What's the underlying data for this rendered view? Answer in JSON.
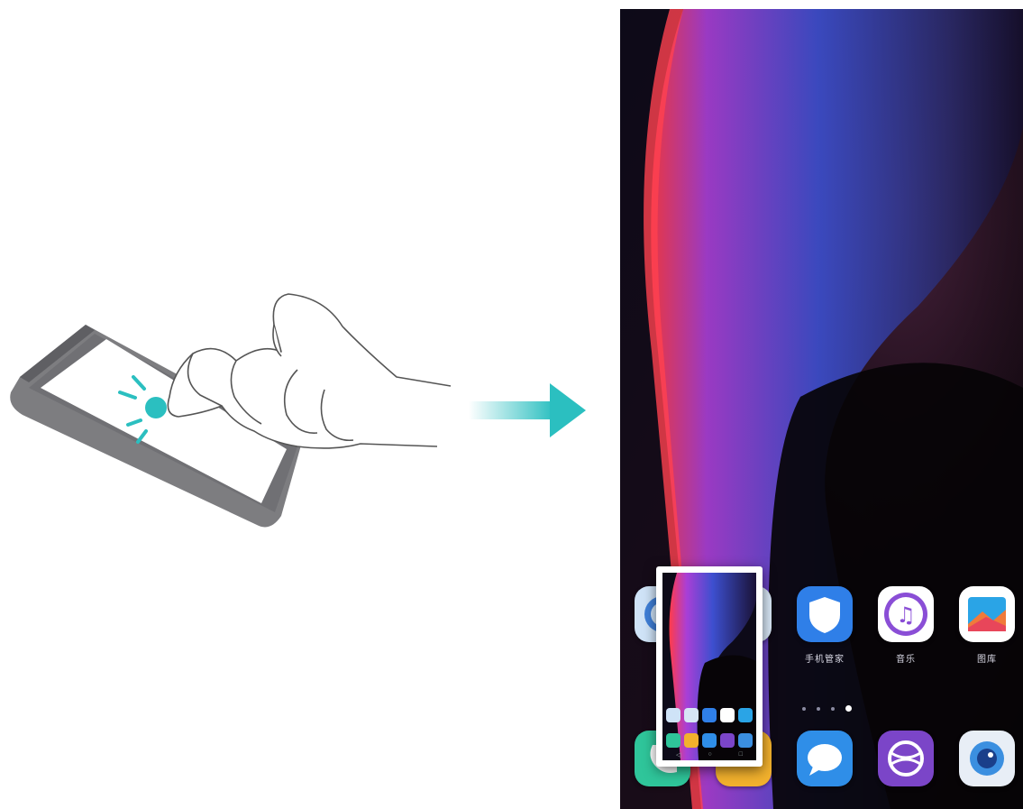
{
  "illustration": {
    "description_icon": "hand-double-knuckle-tap-icon"
  },
  "arrow": {
    "icon": "right-arrow-icon",
    "color": "#2bbfc0"
  },
  "home_screen": {
    "row1": [
      {
        "name": "settings-app",
        "label": "",
        "icon": "settings-icon",
        "color": "#cfe3f7"
      },
      {
        "name": "files-app",
        "label": "",
        "icon": "files-icon",
        "color": "#d7e6f5"
      },
      {
        "name": "phone-manager-app",
        "label": "手机管家",
        "icon": "shield-icon",
        "color": "#2f7fe8"
      },
      {
        "name": "music-app",
        "label": "音乐",
        "icon": "music-note-icon",
        "color": "#8a4ed6"
      },
      {
        "name": "gallery-app",
        "label": "图库",
        "icon": "gallery-icon",
        "color": "#2aa4e6"
      }
    ],
    "dock": [
      {
        "name": "phone-app",
        "icon": "phone-icon",
        "color": "#2fc59a"
      },
      {
        "name": "contacts-app",
        "icon": "contacts-icon",
        "color": "#f2b12d"
      },
      {
        "name": "messages-app",
        "icon": "messages-icon",
        "color": "#2f8ee8"
      },
      {
        "name": "browser-app",
        "icon": "browser-icon",
        "color": "#7b45c8"
      },
      {
        "name": "camera-app",
        "icon": "camera-icon",
        "color": "#3b8fe0"
      }
    ],
    "page_count": 4,
    "active_page": 4
  },
  "screenshot_thumbnail": {
    "nav": [
      "◁",
      "○",
      "□"
    ]
  }
}
